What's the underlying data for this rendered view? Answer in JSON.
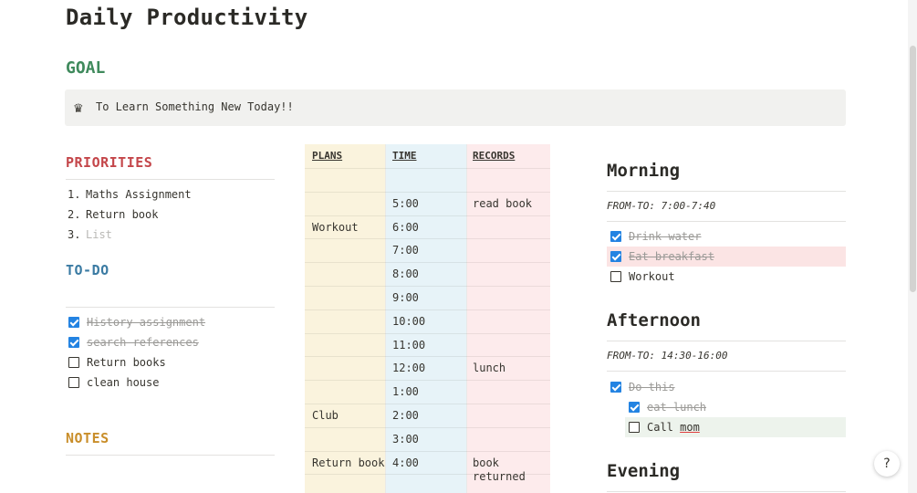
{
  "page": {
    "title": "Daily Productivity"
  },
  "goal": {
    "heading": "GOAL",
    "icon": "crown-icon",
    "text": "To Learn Something New Today!!"
  },
  "priorities": {
    "heading": "PRIORITIES",
    "items": [
      {
        "num": "1.",
        "label": "Maths Assignment"
      },
      {
        "num": "2.",
        "label": "Return book"
      },
      {
        "num": "3.",
        "label": "List"
      }
    ]
  },
  "todo": {
    "heading": "TO-DO",
    "items": [
      {
        "label": "History assignment ",
        "checked": true
      },
      {
        "label": "search references",
        "checked": true
      },
      {
        "label": "Return books",
        "checked": false
      },
      {
        "label": "clean house",
        "checked": false
      }
    ]
  },
  "notes": {
    "heading": "NOTES"
  },
  "schedule": {
    "headers": {
      "plans": "PLANS",
      "time": "TIME",
      "records": "RECORDS"
    },
    "rows": [
      {
        "plans": "",
        "time": "",
        "records": ""
      },
      {
        "plans": "",
        "time": "5:00",
        "records": "read book"
      },
      {
        "plans": "Workout",
        "time": "6:00",
        "records": ""
      },
      {
        "plans": "",
        "time": "7:00",
        "records": ""
      },
      {
        "plans": "",
        "time": "8:00",
        "records": ""
      },
      {
        "plans": "",
        "time": "9:00",
        "records": ""
      },
      {
        "plans": "",
        "time": "10:00",
        "records": ""
      },
      {
        "plans": "",
        "time": "11:00",
        "records": ""
      },
      {
        "plans": "",
        "time": "12:00",
        "records": "lunch"
      },
      {
        "plans": "",
        "time": "1:00",
        "records": ""
      },
      {
        "plans": "Club",
        "time": "2:00",
        "records": ""
      },
      {
        "plans": "",
        "time": "3:00",
        "records": ""
      },
      {
        "plans": "Return book",
        "time": "4:00",
        "records": "book returned"
      }
    ]
  },
  "morning": {
    "heading": "Morning",
    "fromto": "FROM-TO: 7:00-7:40",
    "items": [
      {
        "label": "Drink water",
        "checked": true
      },
      {
        "label": "Eat breakfast",
        "checked": true
      },
      {
        "label": "Workout",
        "checked": false
      }
    ]
  },
  "afternoon": {
    "heading": "Afternoon",
    "fromto": "FROM-TO: 14:30-16:00",
    "items": [
      {
        "label": "Do this",
        "checked": true
      },
      {
        "label": "eat lunch",
        "checked": true
      },
      {
        "label_prefix": "Call ",
        "label_word": "mom",
        "checked": false
      }
    ]
  },
  "evening": {
    "heading": "Evening"
  },
  "help": {
    "label": "?"
  },
  "colors": {
    "goal": "#3f8a5c",
    "priorities": "#c4464a",
    "todo": "#3b7ba3",
    "notes": "#c98e2a",
    "checkbox": "#2383e2",
    "plans_col": "#faf3dd",
    "time_col": "#e7f3f8",
    "records_col": "#fdebec"
  }
}
